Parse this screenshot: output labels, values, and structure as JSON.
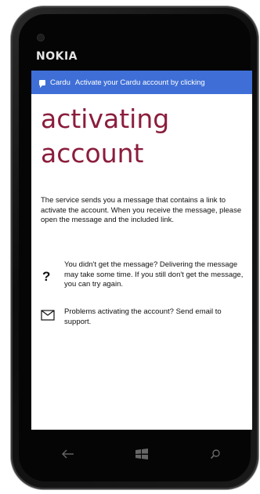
{
  "device": {
    "brand": "NOKIA"
  },
  "toast": {
    "app": "Cardu",
    "message": "Activate your Cardu account by clicking"
  },
  "page": {
    "title": "activating account",
    "description": "The service sends you a message that contains a link to activate the account. When you  receive the message, please open the message and the included link.",
    "items": [
      {
        "icon": "question-mark-icon",
        "text": "You didn't get the message? Delivering the message may take some time. If you still don't get the message, you can try again."
      },
      {
        "icon": "envelope-icon",
        "text": "Problems activating the account? Send email to support."
      }
    ]
  },
  "colors": {
    "accent": "#8b1d3c",
    "toast": "#3f6fd6"
  }
}
